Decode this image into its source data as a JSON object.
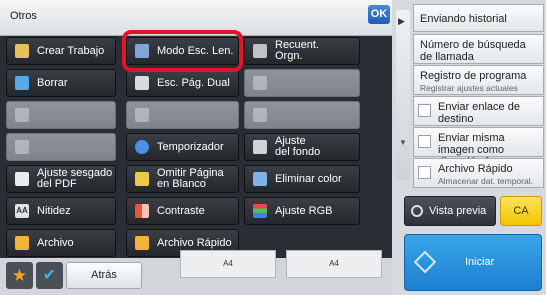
{
  "header": {
    "title": "Otros",
    "ok_label": "OK"
  },
  "buttons": {
    "crear_trabajo": "Crear Trabajo",
    "modo_esc_len": "Modo Esc. Len.",
    "recuent_l1": "Recuent.",
    "recuent_l2": "Orgn.",
    "borrar": "Borrar",
    "esc_pag_dual": "Esc. Pág. Dual",
    "temporizador": "Temporizador",
    "ajuste_fondo_l1": "Ajuste",
    "ajuste_fondo_l2": "del fondo",
    "ajuste_sesgado_l1": "Ajuste sesgado",
    "ajuste_sesgado_l2": "del PDF",
    "omitir_l1": "Omitir Página",
    "omitir_l2": "en Blanco",
    "eliminar_color": "Eliminar color",
    "nitidez": "Nitidez",
    "contraste": "Contraste",
    "ajuste_rgb": "Ajuste RGB",
    "archivo": "Archivo",
    "archivo_rapido": "Archivo Rápido",
    "atras": "Atrás"
  },
  "bottom_papers": [
    "A4",
    "A4"
  ],
  "right_panel": {
    "enviando_historial": "Enviando historial",
    "numero_busqueda": "Número de búsqueda de llamada",
    "registro_programa": "Registro de programa",
    "registro_programa_sub": "Registrar ajustes actuales",
    "enviar_enlace": "Enviar enlace de destino",
    "enviar_misma": "Enviar misma imagen como dirección  fax",
    "archivo_rapido": "Archivo Rápido",
    "archivo_rapido_sub": "Almacenar dat. temporal.",
    "vista_previa": "Vista previa",
    "ca": "CA",
    "iniciar": "Iniciar"
  },
  "colors": {
    "highlight": "#e0142d",
    "start_button": "#1c7fd0",
    "ca_button": "#f1c500",
    "ok_button": "#1f5fb8"
  }
}
